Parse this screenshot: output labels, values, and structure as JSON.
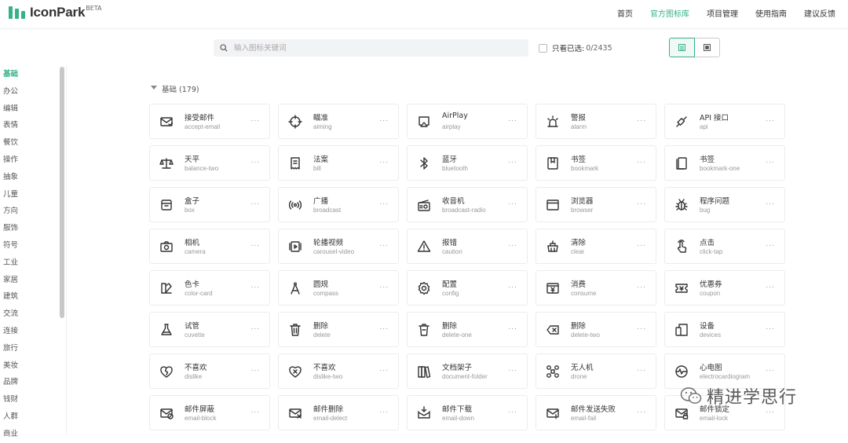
{
  "header": {
    "logo_text": "IconPark",
    "logo_badge": "BETA",
    "nav": [
      {
        "label": "首页",
        "active": false
      },
      {
        "label": "官方图标库",
        "active": true
      },
      {
        "label": "项目管理",
        "active": false
      },
      {
        "label": "使用指南",
        "active": false
      },
      {
        "label": "建议反馈",
        "active": false
      }
    ]
  },
  "toolbar": {
    "search_placeholder": "输入图标关键词",
    "only_selected_label": "只看已选:",
    "selected_count": "0/2435"
  },
  "sidebar": {
    "items": [
      "基础",
      "办公",
      "编辑",
      "表情",
      "餐饮",
      "操作",
      "抽象",
      "儿童",
      "方向",
      "服饰",
      "符号",
      "工业",
      "家居",
      "建筑",
      "交流",
      "连接",
      "旅行",
      "美妆",
      "品牌",
      "钱财",
      "人群",
      "商业"
    ],
    "active_index": 0
  },
  "section": {
    "title": "基础 (179)"
  },
  "icons": [
    {
      "zh": "接受邮件",
      "en": "accept-email",
      "icon": "mail-accept-icon"
    },
    {
      "zh": "瞄准",
      "en": "aiming",
      "icon": "aiming-icon"
    },
    {
      "zh": "AirPlay",
      "en": "airplay",
      "icon": "airplay-icon"
    },
    {
      "zh": "警报",
      "en": "alarm",
      "icon": "alarm-icon"
    },
    {
      "zh": "API 接口",
      "en": "api",
      "icon": "api-plug-icon"
    },
    {
      "zh": "天平",
      "en": "balance-two",
      "icon": "balance-icon"
    },
    {
      "zh": "法案",
      "en": "bill",
      "icon": "bill-icon"
    },
    {
      "zh": "蓝牙",
      "en": "bluetooth",
      "icon": "bluetooth-icon"
    },
    {
      "zh": "书签",
      "en": "bookmark",
      "icon": "bookmark-icon"
    },
    {
      "zh": "书签",
      "en": "bookmark-one",
      "icon": "bookmark-one-icon"
    },
    {
      "zh": "盒子",
      "en": "box",
      "icon": "box-icon"
    },
    {
      "zh": "广播",
      "en": "broadcast",
      "icon": "broadcast-icon"
    },
    {
      "zh": "收音机",
      "en": "broadcast-radio",
      "icon": "radio-icon"
    },
    {
      "zh": "浏览器",
      "en": "browser",
      "icon": "browser-icon"
    },
    {
      "zh": "程序问题",
      "en": "bug",
      "icon": "bug-icon"
    },
    {
      "zh": "相机",
      "en": "camera",
      "icon": "camera-icon"
    },
    {
      "zh": "轮播视频",
      "en": "carousel-video",
      "icon": "carousel-video-icon"
    },
    {
      "zh": "报错",
      "en": "caution",
      "icon": "caution-icon"
    },
    {
      "zh": "清除",
      "en": "clear",
      "icon": "clear-icon"
    },
    {
      "zh": "点击",
      "en": "click-tap",
      "icon": "click-tap-icon"
    },
    {
      "zh": "色卡",
      "en": "color-card",
      "icon": "color-card-icon"
    },
    {
      "zh": "圆规",
      "en": "compass",
      "icon": "compass-icon"
    },
    {
      "zh": "配置",
      "en": "config",
      "icon": "config-icon"
    },
    {
      "zh": "消费",
      "en": "consume",
      "icon": "consume-icon"
    },
    {
      "zh": "优惠券",
      "en": "coupon",
      "icon": "coupon-icon"
    },
    {
      "zh": "试管",
      "en": "cuvette",
      "icon": "cuvette-icon"
    },
    {
      "zh": "删除",
      "en": "delete",
      "icon": "delete-icon"
    },
    {
      "zh": "删除",
      "en": "delete-one",
      "icon": "delete-one-icon"
    },
    {
      "zh": "删除",
      "en": "delete-two",
      "icon": "delete-two-icon"
    },
    {
      "zh": "设备",
      "en": "devices",
      "icon": "devices-icon"
    },
    {
      "zh": "不喜欢",
      "en": "dislike",
      "icon": "dislike-icon"
    },
    {
      "zh": "不喜欢",
      "en": "dislike-two",
      "icon": "dislike-two-icon"
    },
    {
      "zh": "文档架子",
      "en": "document-folder",
      "icon": "document-folder-icon"
    },
    {
      "zh": "无人机",
      "en": "drone",
      "icon": "drone-icon"
    },
    {
      "zh": "心电图",
      "en": "electrocardiogram",
      "icon": "ecg-icon"
    },
    {
      "zh": "邮件屏蔽",
      "en": "email-block",
      "icon": "email-block-icon"
    },
    {
      "zh": "邮件删除",
      "en": "email-delect",
      "icon": "email-delete-icon"
    },
    {
      "zh": "邮件下载",
      "en": "email-down",
      "icon": "email-down-icon"
    },
    {
      "zh": "邮件发送失败",
      "en": "email-fail",
      "icon": "email-fail-icon"
    },
    {
      "zh": "邮件锁定",
      "en": "email-lock",
      "icon": "email-lock-icon"
    }
  ],
  "card_more": "...",
  "watermark": {
    "text": "精进学思行",
    "icon": "wechat-icon"
  },
  "colors": {
    "accent": "#35b28b"
  }
}
